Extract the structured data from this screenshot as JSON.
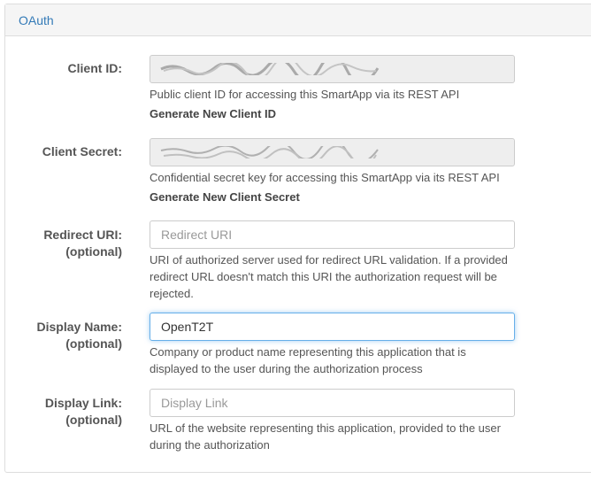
{
  "panel": {
    "title": "OAuth"
  },
  "client_id": {
    "label": "Client ID:",
    "help": "Public client ID for accessing this SmartApp via its REST API",
    "action": "Generate New Client ID"
  },
  "client_secret": {
    "label": "Client Secret:",
    "help": "Confidential secret key for accessing this SmartApp via its REST API",
    "action": "Generate New Client Secret"
  },
  "redirect_uri": {
    "label": "Redirect URI:",
    "optional": "(optional)",
    "placeholder": "Redirect URI",
    "value": "",
    "help": "URI of authorized server used for redirect URL validation. If a provided redirect URL doesn't match this URI the authorization request will be rejected."
  },
  "display_name": {
    "label": "Display Name:",
    "optional": "(optional)",
    "placeholder": "",
    "value": "OpenT2T",
    "help": "Company or product name representing this application that is displayed to the user during the authorization process"
  },
  "display_link": {
    "label": "Display Link:",
    "optional": "(optional)",
    "placeholder": "Display Link",
    "value": "",
    "help": "URL of the website representing this application, provided to the user during the authorization"
  },
  "colors": {
    "heading_text": "#337ab7",
    "readonly_bg": "#eeeeee",
    "focus_border": "#66afe9"
  }
}
